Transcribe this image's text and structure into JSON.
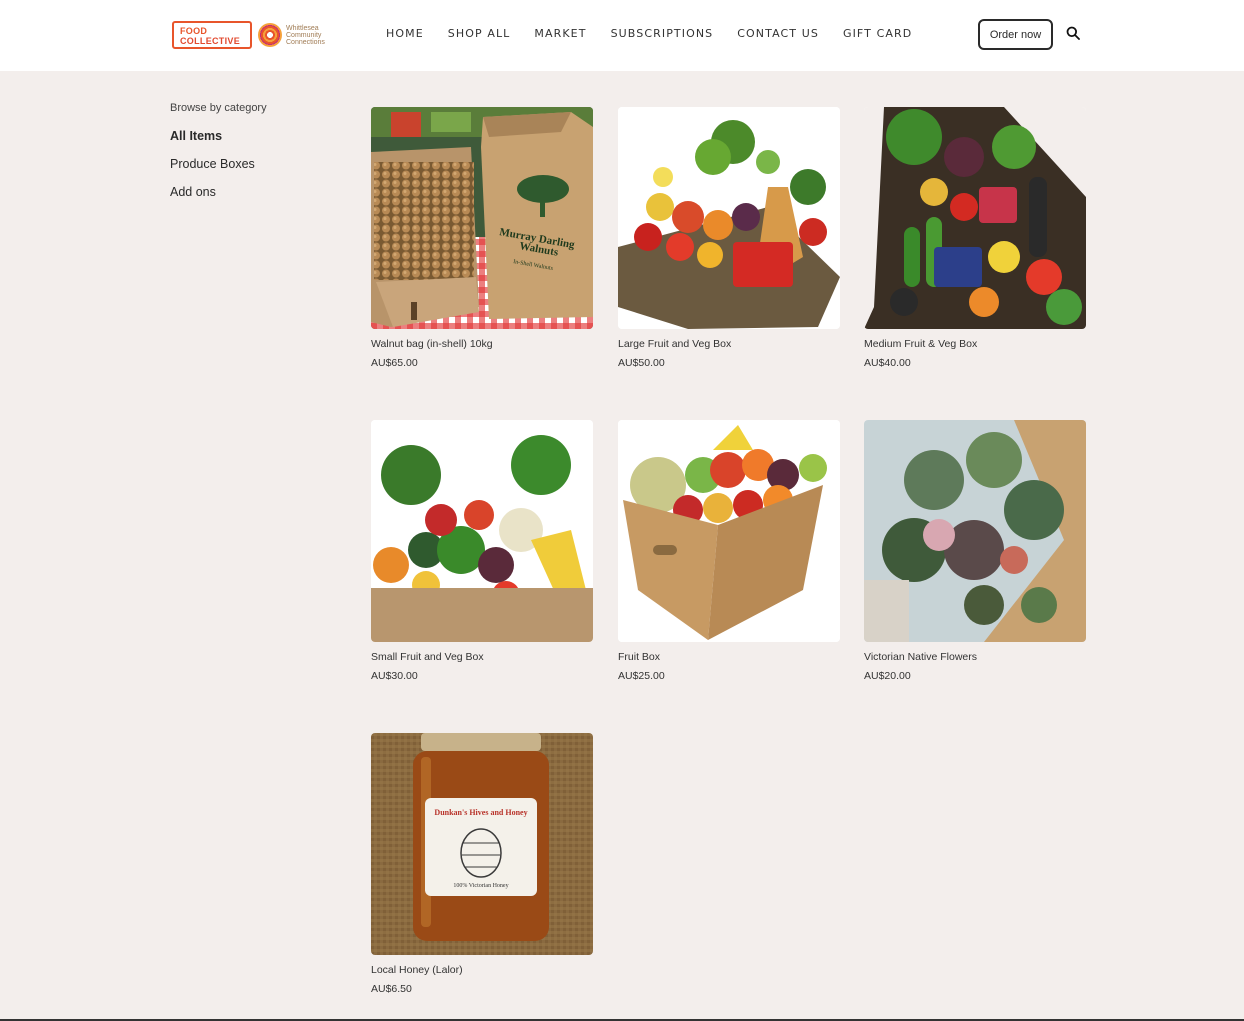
{
  "header": {
    "logo_food_line1": "FOOD",
    "logo_food_line2": "COLLECTIVE",
    "logo_wcc_line1": "Whittlesea",
    "logo_wcc_line2": "Community",
    "logo_wcc_line3": "Connections",
    "nav": [
      "HOME",
      "SHOP ALL",
      "MARKET",
      "SUBSCRIPTIONS",
      "CONTACT US",
      "GIFT CARD"
    ],
    "order_label": "Order now",
    "search_icon": "search-icon"
  },
  "sidebar": {
    "heading": "Browse by category",
    "items": [
      "All Items",
      "Produce Boxes",
      "Add ons"
    ]
  },
  "products": [
    {
      "name": "Walnut bag (in-shell) 10kg",
      "price": "AU$65.00",
      "bag_text_1": "Murray Darling",
      "bag_text_2": "Walnuts",
      "bag_text_3": "In-Shell Walnuts"
    },
    {
      "name": "Large Fruit and Veg Box",
      "price": "AU$50.00"
    },
    {
      "name": "Medium Fruit & Veg Box",
      "price": "AU$40.00"
    },
    {
      "name": "Small Fruit and Veg Box",
      "price": "AU$30.00"
    },
    {
      "name": "Fruit Box",
      "price": "AU$25.00"
    },
    {
      "name": "Victorian Native Flowers",
      "price": "AU$20.00"
    },
    {
      "name": "Local Honey (Lalor)",
      "price": "AU$6.50",
      "label_text_1": "Dunkan's Hives and Honey",
      "label_text_2": "100% Victorian Honey"
    }
  ]
}
